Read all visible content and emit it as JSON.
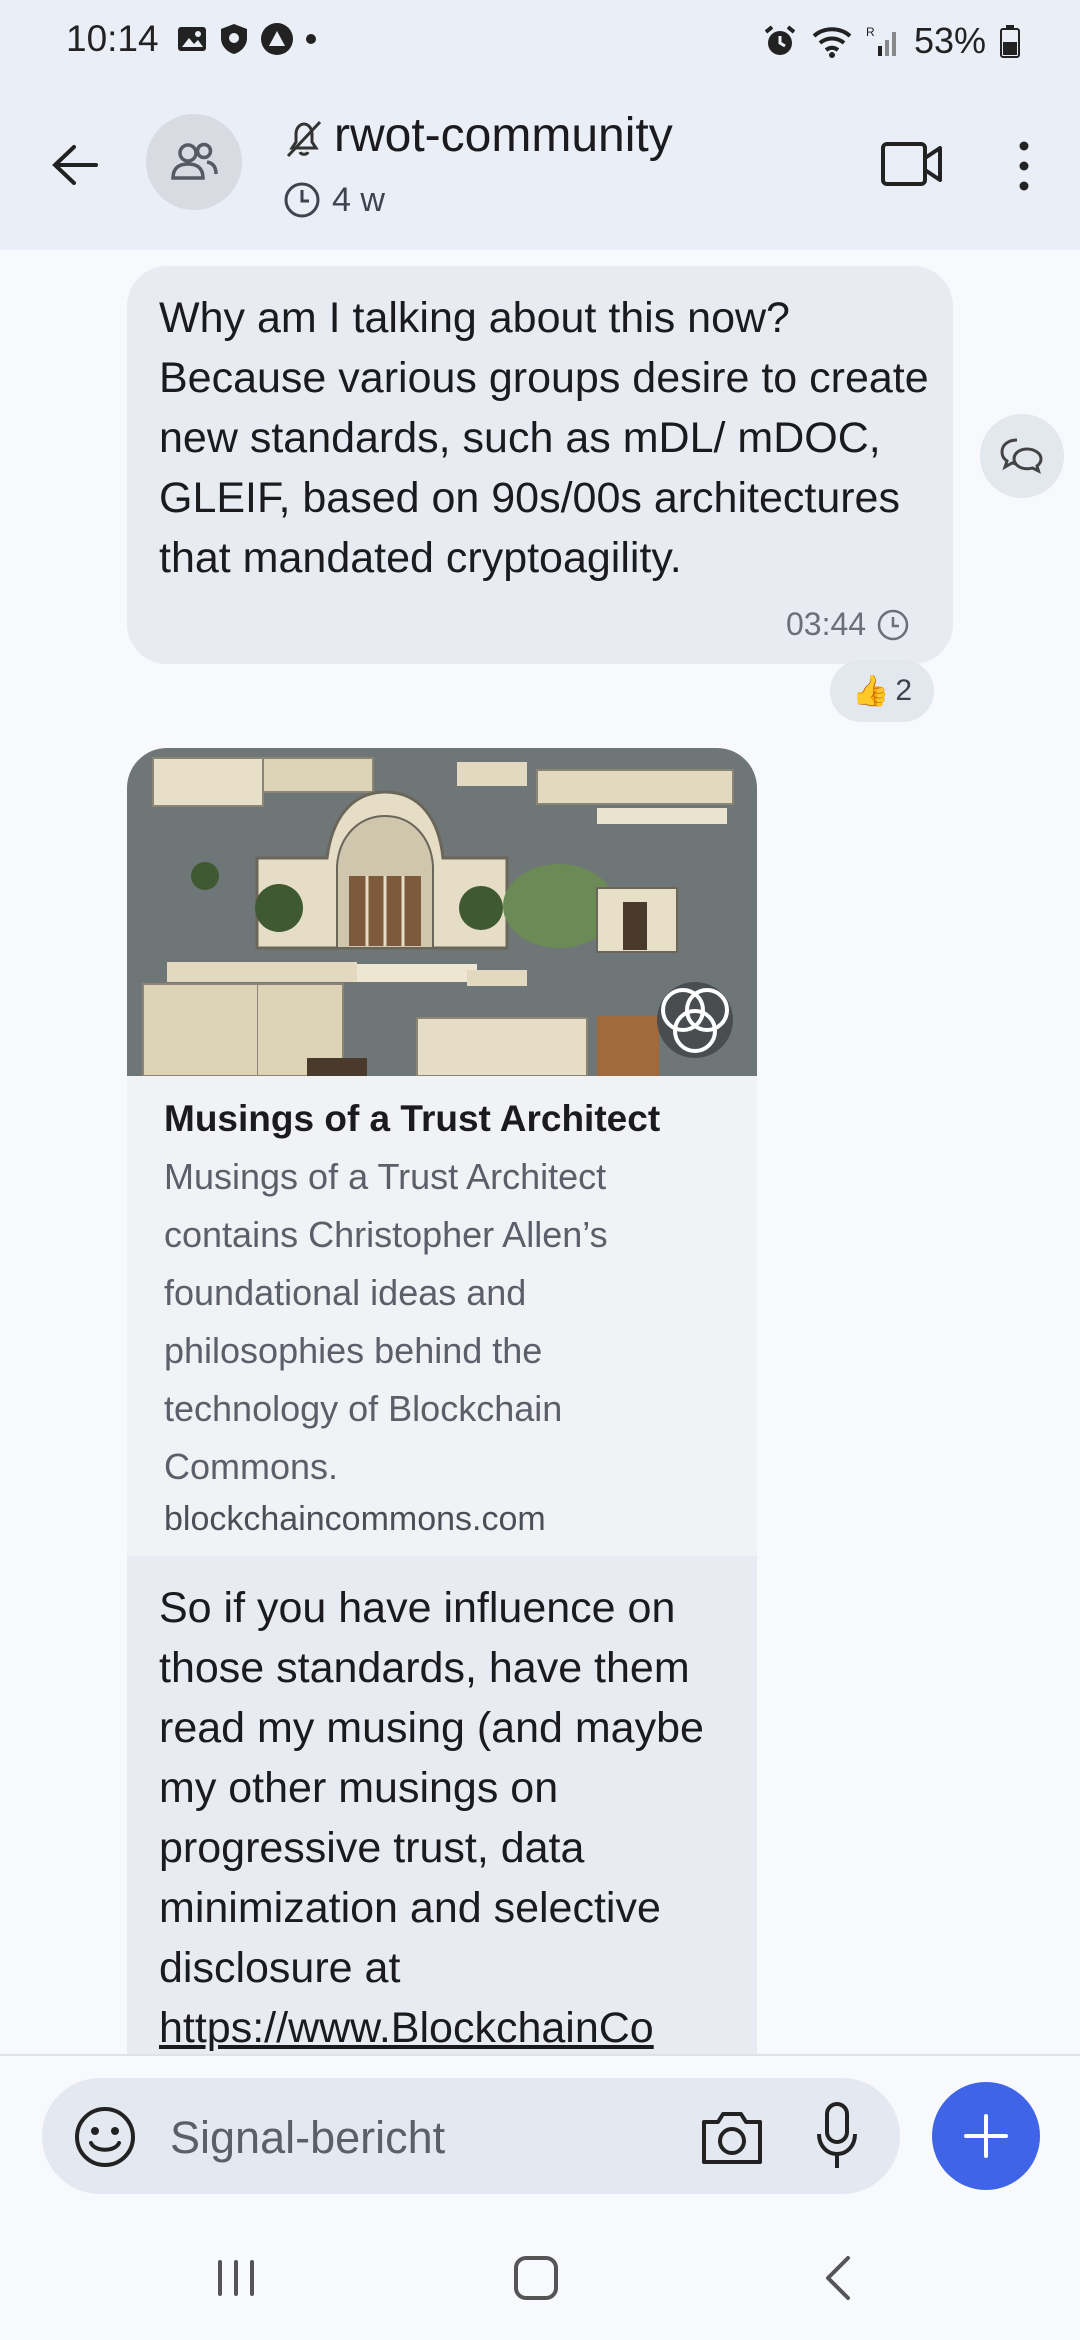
{
  "status_bar": {
    "time": "10:14",
    "battery": "53%"
  },
  "header": {
    "title": "rwot-community",
    "timer": "4 w"
  },
  "messages": [
    {
      "text": "Why am I talking about this now? Because various groups desire to create new standards, such as mDL/ mDOC, GLEIF, based on 90s/00s architectures that mandated cryptoagility.",
      "time": "03:44",
      "reaction": {
        "emoji": "👍",
        "count": "2"
      }
    }
  ],
  "link_preview": {
    "title": "Musings of a Trust Architect",
    "description": "Musings of a Trust Architect contains Christopher Allen’s foundational ideas and philosophies behind the technology of Blockchain Commons.",
    "domain": "blockchaincommons.com",
    "message_text": "So if you have influence on those standards, have them read my musing (and maybe my other musings on progressive trust, data minimization and selective disclosure at ",
    "message_link": "https://www.BlockchainCo"
  },
  "composer": {
    "placeholder": "Signal-bericht"
  },
  "colors": {
    "accent": "#3f64e8",
    "header_bg": "#eaeef6",
    "bubble_bg": "#e8ebf1"
  },
  "icons": {
    "back": "arrow-left-icon",
    "avatar": "group-icon",
    "mute": "bell-off-icon",
    "timer": "timer-icon",
    "video": "video-camera-icon",
    "more": "more-vertical-icon",
    "reply": "reply-icon",
    "emoji": "emoji-icon",
    "camera": "camera-icon",
    "mic": "microphone-icon",
    "plus": "plus-icon"
  }
}
